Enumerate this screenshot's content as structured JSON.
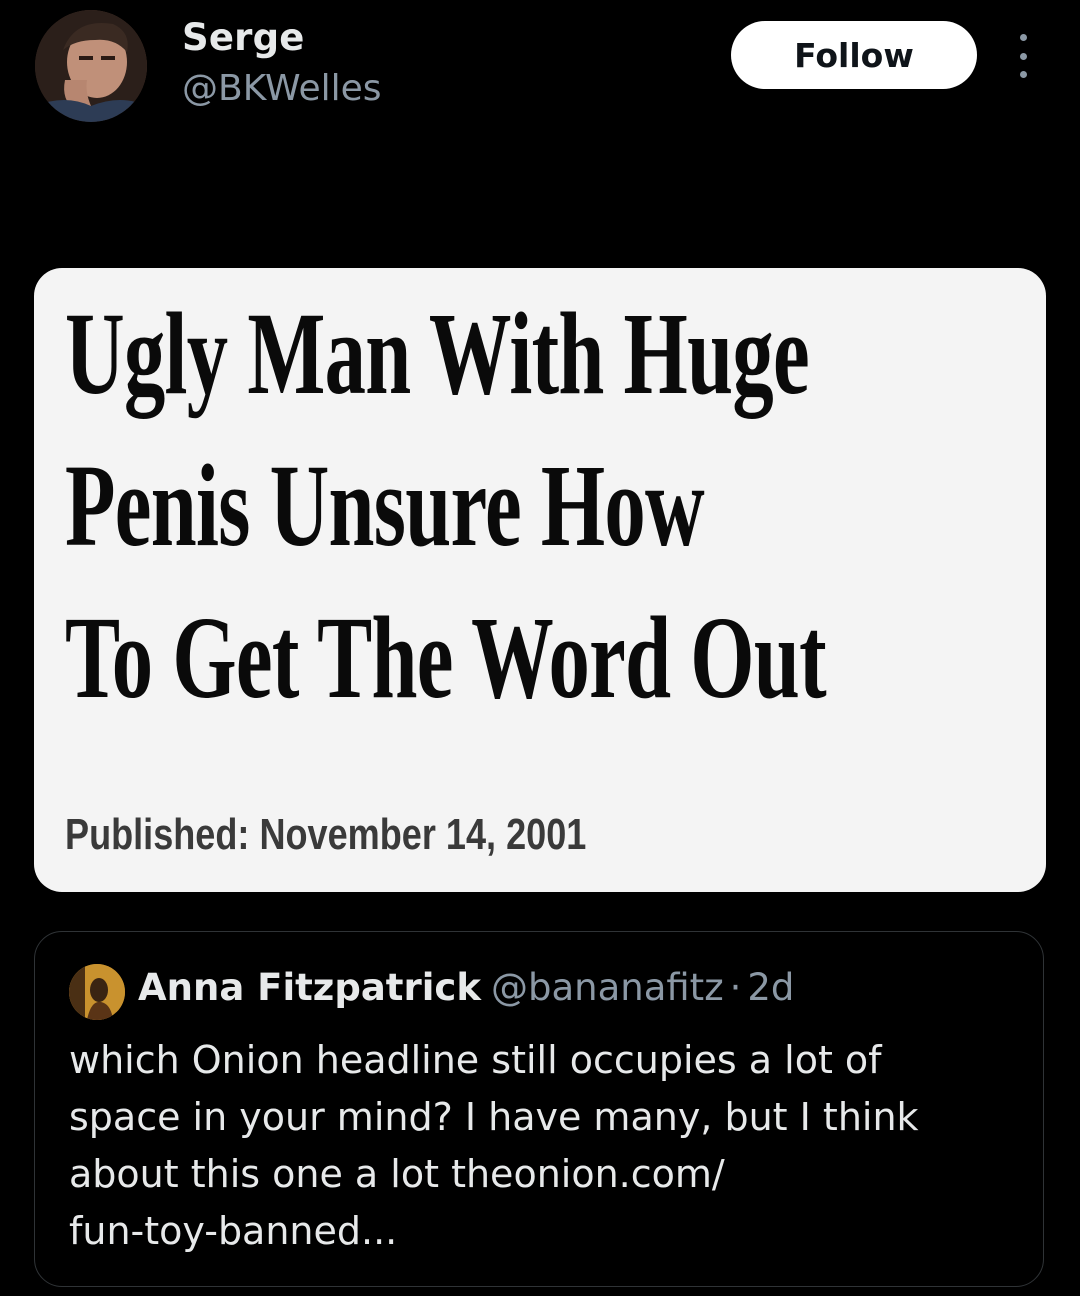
{
  "author": {
    "name": "Serge",
    "handle": "@BKWelles"
  },
  "actions": {
    "follow_label": "Follow",
    "more_icon": "more-vertical-icon"
  },
  "card": {
    "headline_lines": [
      "Ugly Man With Huge",
      "Penis Unsure How",
      "To Get The Word Out"
    ],
    "published": "Published: November 14, 2001"
  },
  "quote": {
    "name": "Anna Fitzpatrick",
    "handle": "@bananafitz",
    "separator": "·",
    "time": "2d",
    "body_lines": [
      "which Onion headline still occupies a lot of",
      "space in your mind? I have many, but I think",
      "about this one a lot theonion.com/",
      "fun-toy-banned..."
    ]
  },
  "colors": {
    "background": "#000000",
    "primary_text": "#e7e9ea",
    "secondary_text": "#8b98a5",
    "border": "#2f3336",
    "follow_bg": "#ffffff",
    "card_bg": "#f4f4f4"
  }
}
